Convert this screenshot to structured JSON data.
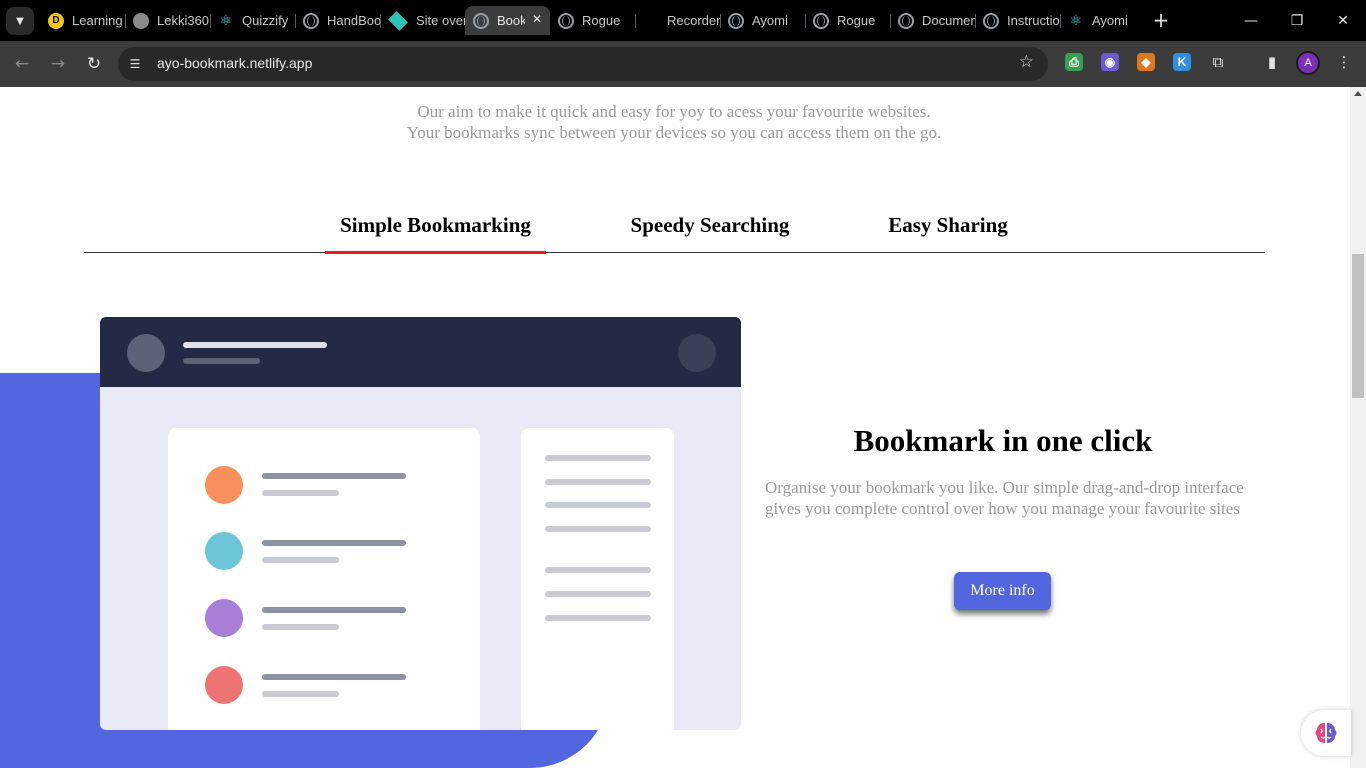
{
  "browser": {
    "tabs": [
      {
        "title": "Learning",
        "icon": "yellow-d-icon",
        "active": false
      },
      {
        "title": "Lekki360",
        "icon": "github-icon",
        "active": false
      },
      {
        "title": "Quizzify",
        "icon": "react-icon",
        "active": false
      },
      {
        "title": "HandBook",
        "icon": "globe-icon",
        "active": false
      },
      {
        "title": "Site overview",
        "icon": "netlify-icon",
        "active": false
      },
      {
        "title": "Bookmark",
        "icon": "globe-icon",
        "active": true
      },
      {
        "title": "Rogue",
        "icon": "globe-icon",
        "active": false
      },
      {
        "title": "Recorder",
        "icon": "microsoft-icon",
        "active": false
      },
      {
        "title": "Ayomi",
        "icon": "globe-icon",
        "active": false
      },
      {
        "title": "Rogue",
        "icon": "globe-icon",
        "active": false
      },
      {
        "title": "Documents",
        "icon": "globe-icon",
        "active": false
      },
      {
        "title": "Instructions",
        "icon": "globe-icon",
        "active": false
      },
      {
        "title": "Ayomi",
        "icon": "react-icon",
        "active": false
      }
    ],
    "url": "ayo-bookmark.netlify.app",
    "profile_initial": "A"
  },
  "page": {
    "intro": "Our aim to make it quick and easy for yoy to acess your favourite websites. Your bookmarks sync between your devices so you can access them on the go.",
    "tabs": [
      {
        "label": "Simple Bookmarking",
        "active": true
      },
      {
        "label": "Speedy Searching",
        "active": false
      },
      {
        "label": "Easy Sharing",
        "active": false
      }
    ],
    "feature": {
      "title": "Bookmark in one click",
      "description": "Organise your bookmark you like. Our simple drag-and-drop interface gives you complete control over how you manage your favourite sites",
      "button": "More info"
    },
    "colors": {
      "accent_blue": "#5267df",
      "active_tab_underline": "#e81b1b",
      "illustration_header": "#242a45",
      "dot_orange": "#f98f5a",
      "dot_teal": "#6cc6d8",
      "dot_purple": "#a87fd6",
      "dot_red": "#ee7474"
    }
  }
}
